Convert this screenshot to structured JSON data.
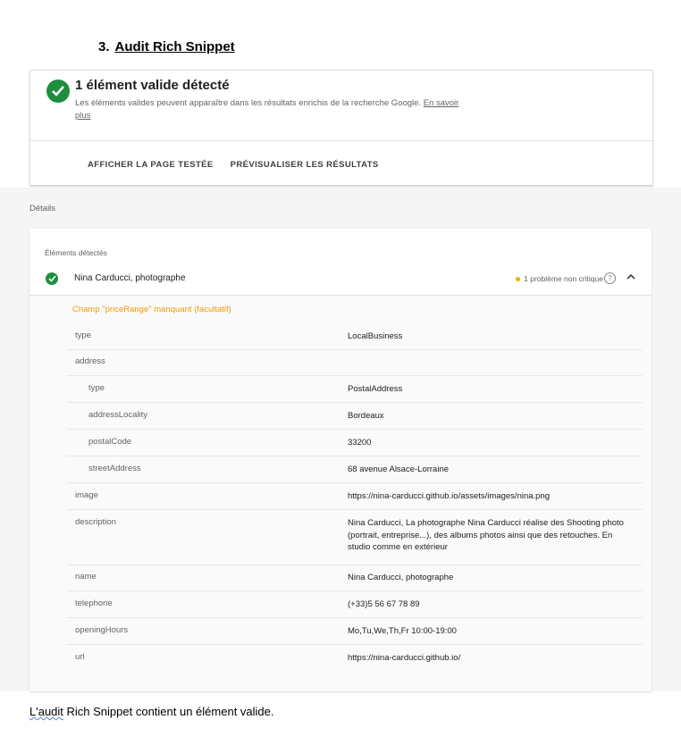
{
  "heading": {
    "number": "3.",
    "title": "Audit Rich Snippet"
  },
  "result": {
    "title": "1 élément valide détecté",
    "desc": "Les éléments valides peuvent apparaître dans les résultats enrichis de la recherche Google.",
    "learn_more": "En savoir plus",
    "actions": [
      "AFFICHER LA PAGE TESTÉE",
      "PRÉVISUALISER LES RÉSULTATS"
    ]
  },
  "details": {
    "label": "Détails",
    "elements_label": "Éléments détectés",
    "item": {
      "name": "Nina Carducci, photographe",
      "issue": "1 problème non critique",
      "help": "?"
    },
    "warning": "Champ \"priceRange\" manquant (facultatif)",
    "rows": [
      {
        "key": "type",
        "value": "LocalBusiness"
      },
      {
        "key": "address",
        "value": ""
      },
      {
        "key": "type",
        "value": "PostalAddress"
      },
      {
        "key": "addressLocality",
        "value": "Bordeaux"
      },
      {
        "key": "postalCode",
        "value": "33200"
      },
      {
        "key": "streetAddress",
        "value": "68 avenue Alsace-Lorraine"
      },
      {
        "key": "image",
        "value": "https://nina-carducci.github.io/assets/images/nina.png"
      },
      {
        "key": "description",
        "value": "Nina Carducci, La photographe Nina Carducci réalise des Shooting photo (portrait, entreprise...), des albums photos ainsi que des retouches. En studio comme en extérieur"
      },
      {
        "key": "name",
        "value": "Nina Carducci, photographe"
      },
      {
        "key": "telephone",
        "value": "(+33)5 56 67 78 89"
      },
      {
        "key": "openingHours",
        "value": "Mo,Tu,We,Th,Fr 10:00-19:00"
      },
      {
        "key": "url",
        "value": "https://nina-carducci.github.io/"
      }
    ]
  },
  "caption": {
    "part1": "L'audit",
    "part2": " Rich ",
    "part3": "Snippet contient un élément valide."
  },
  "colors": {
    "success": "#1e8e3e",
    "warning": "#f29900"
  },
  "icons": [
    "check-circle-icon",
    "help-icon",
    "chevron-up-icon"
  ]
}
